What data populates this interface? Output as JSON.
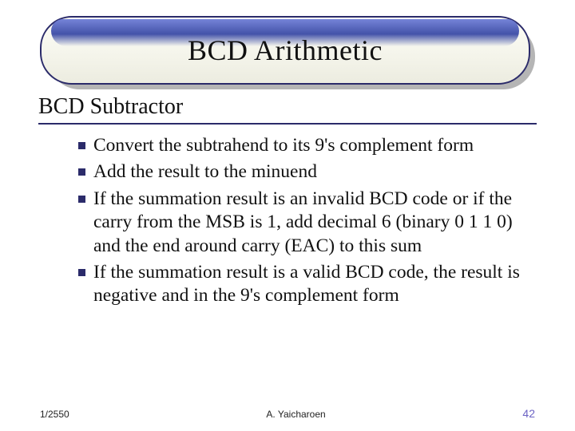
{
  "title": "BCD Arithmetic",
  "subhead": "BCD Subtractor",
  "bullets": {
    "b1": "Convert the subtrahend to its 9's complement form",
    "b2": "Add the result to the minuend",
    "b3": "If the summation result is an invalid BCD code or if the carry from the MSB is 1, add decimal 6 (binary 0 1 1 0) and the end around carry (EAC) to this sum",
    "b4": "If the summation result is a valid BCD code, the result is negative and in the 9's complement form"
  },
  "footer": {
    "date": "1/2550",
    "author": "A. Yaicharoen",
    "page": "42"
  }
}
